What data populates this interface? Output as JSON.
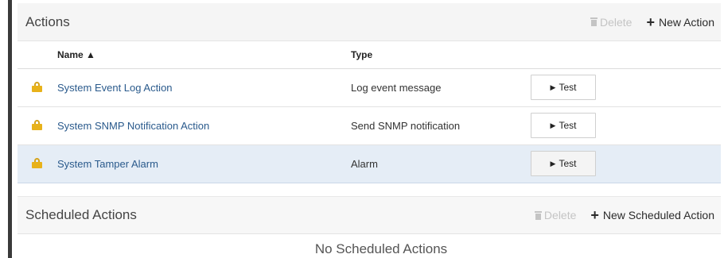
{
  "actions": {
    "title": "Actions",
    "delete_label": "Delete",
    "new_label": "New Action",
    "columns": {
      "name": "Name ▲",
      "type": "Type"
    },
    "rows": [
      {
        "name": "System Event Log Action",
        "type": "Log event message",
        "test_label": "Test"
      },
      {
        "name": "System SNMP Notification Action",
        "type": "Send SNMP notification",
        "test_label": "Test"
      },
      {
        "name": "System Tamper Alarm",
        "type": "Alarm",
        "test_label": "Test"
      }
    ]
  },
  "scheduled": {
    "title": "Scheduled Actions",
    "delete_label": "Delete",
    "new_label": "New Scheduled Action",
    "empty_text": "No Scheduled Actions"
  },
  "colors": {
    "lock": "#e8b21a",
    "link": "#2a5a8c",
    "selected_row": "#e5edf6"
  },
  "icons": [
    "trash-icon",
    "plus-icon",
    "lock-icon",
    "play-icon"
  ]
}
